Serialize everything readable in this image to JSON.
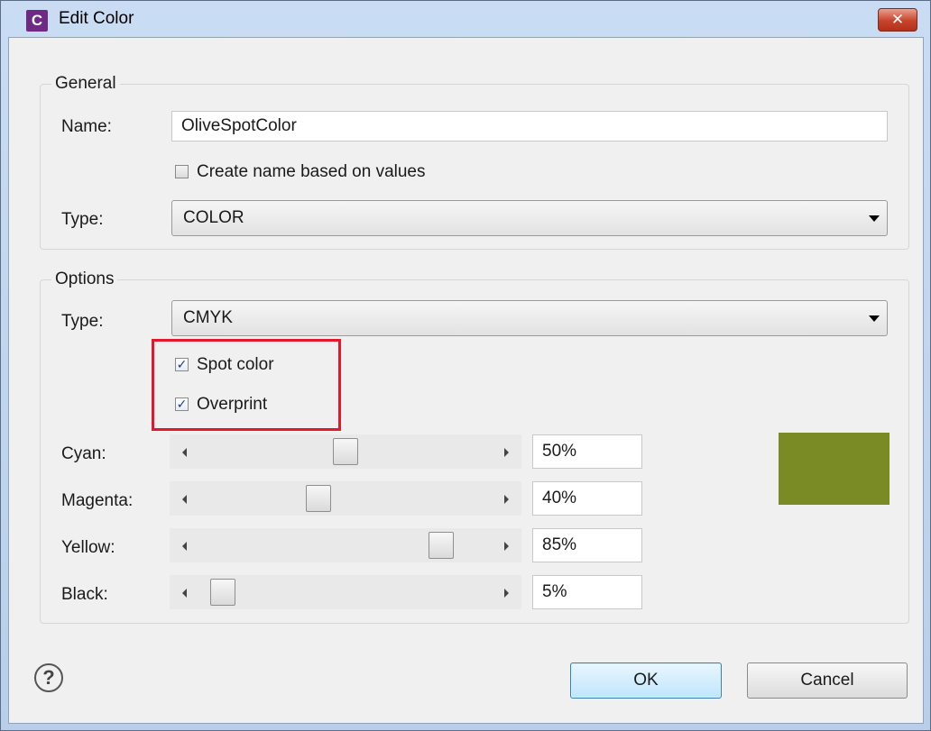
{
  "window": {
    "title": "Edit Color",
    "app_icon_letter": "C",
    "close_glyph": "✕"
  },
  "general": {
    "legend": "General",
    "name_label": "Name:",
    "name_value": "OliveSpotColor",
    "create_name_label": "Create name based on values",
    "create_name_checked": false,
    "type_label": "Type:",
    "type_value": "COLOR"
  },
  "options": {
    "legend": "Options",
    "type_label": "Type:",
    "type_value": "CMYK",
    "spot_color_label": "Spot color",
    "spot_color_checked": true,
    "overprint_label": "Overprint",
    "overprint_checked": true,
    "channels": [
      {
        "label": "Cyan:",
        "value": "50%",
        "fraction": 0.5
      },
      {
        "label": "Magenta:",
        "value": "40%",
        "fraction": 0.4
      },
      {
        "label": "Yellow:",
        "value": "85%",
        "fraction": 0.85
      },
      {
        "label": "Black:",
        "value": "5%",
        "fraction": 0.05
      }
    ],
    "swatch_color": "#7a8b26"
  },
  "footer": {
    "help_glyph": "?",
    "ok_label": "OK",
    "cancel_label": "Cancel"
  },
  "icons": {
    "check_glyph": "✓"
  },
  "colors": {
    "highlight": "#e5182b"
  }
}
